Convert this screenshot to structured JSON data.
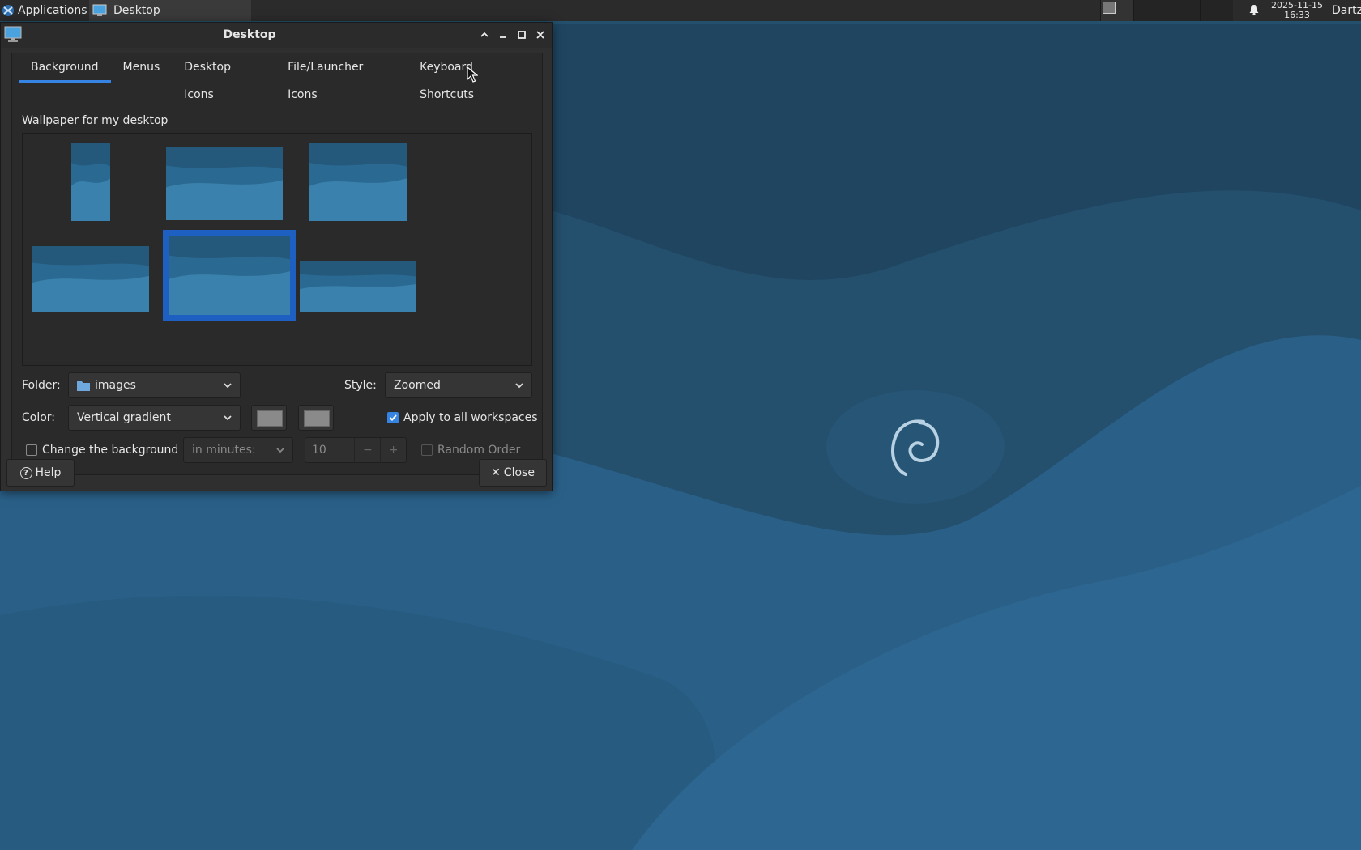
{
  "panel": {
    "applications_label": "Applications",
    "task_title": "Desktop",
    "clock_date": "2025-11-15",
    "clock_time": "16:33",
    "user": "Dartz"
  },
  "window": {
    "title": "Desktop",
    "tabs": [
      "Background",
      "Menus",
      "Desktop Icons",
      "File/Launcher Icons",
      "Keyboard Shortcuts"
    ],
    "active_tab": "Background",
    "wallpaper_label": "Wallpaper for my desktop",
    "folder_label": "Folder:",
    "folder_value": "images",
    "style_label": "Style:",
    "style_value": "Zoomed",
    "color_label": "Color:",
    "color_value": "Vertical gradient",
    "apply_all_label": "Apply to all workspaces",
    "apply_all_checked": true,
    "change_bg_label": "Change the background",
    "change_bg_checked": false,
    "interval_value": "in minutes:",
    "minutes_value": "10",
    "random_order_label": "Random Order",
    "help_label": "Help",
    "close_label": "Close",
    "colors": {
      "accent": "#3584e4",
      "selection": "#1e5fc2",
      "swatch": "#8a8a8a"
    }
  },
  "desktop": {
    "background": "#20506f",
    "logo": "debian-swirl-icon"
  }
}
